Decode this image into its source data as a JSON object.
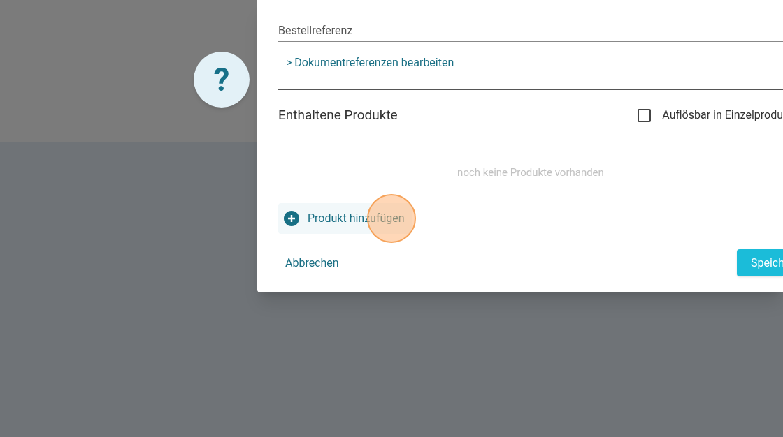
{
  "dialog": {
    "field": {
      "placeholder": "Bestellreferenz"
    },
    "link": "> Dokumentreferenzen bearbeiten",
    "section_title": "Enthaltene Produkte",
    "checkbox": {
      "label": "Auflösbar in Einzelprodu",
      "checked": false
    },
    "empty_text": "noch keine Produkte vorhanden",
    "add_button": "Produkt hinzufügen",
    "cancel_button": "Abbrechen",
    "save_button": "Speich"
  },
  "help_button": "?"
}
